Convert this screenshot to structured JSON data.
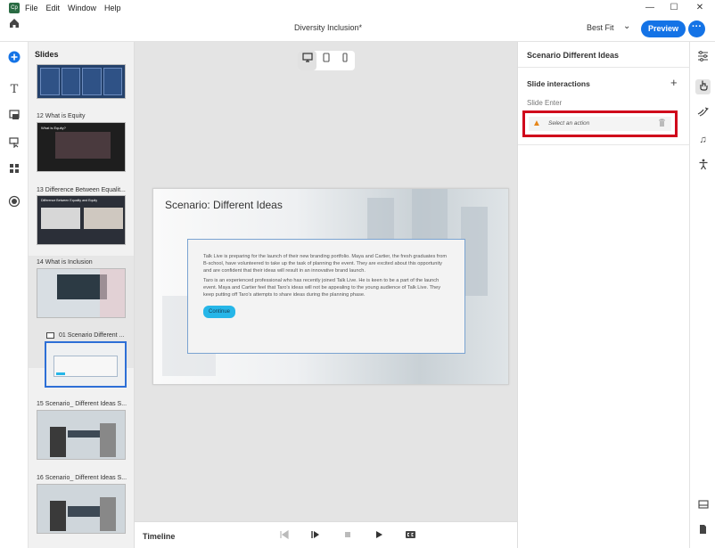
{
  "menu": {
    "app_logo": "Cp",
    "items": [
      "File",
      "Edit",
      "Window",
      "Help"
    ]
  },
  "window_controls": {
    "minimize": "—",
    "maximize": "☐",
    "close": "✕"
  },
  "header": {
    "doc_title": "Diversity Inclusion*",
    "zoom": "Best Fit",
    "preview_label": "Preview",
    "more_label": "···",
    "accent_color": "#1473e6"
  },
  "slides_panel": {
    "title": "Slides",
    "slides": [
      {
        "label": "12  What is Equity",
        "thumb_title": "What is Equity?"
      },
      {
        "label": "13  Difference Between Equalit...",
        "thumb_title": "Difference Between Equality and Equity"
      },
      {
        "label": "14  What is Inclusion"
      },
      {
        "label": "01  Scenario Different ..."
      },
      {
        "label": "15  Scenario_ Different Ideas S..."
      },
      {
        "label": "16  Scenario_ Different Ideas S..."
      }
    ]
  },
  "canvas": {
    "slide_heading": "Scenario: Different Ideas",
    "paragraph1": "Talk Live is preparing for the launch of their new branding portfolio. Maya and Cartier, the fresh graduates from B-school, have volunteered to take up the task of planning the event. They are excited about this opportunity and are confident that their ideas will result in an innovative brand launch.",
    "paragraph2": "Taro is an experienced professional who has recently joined Talk Live. He is keen to be a part of the launch event. Maya and Cartier feel that Taro's ideas will not be appealing to the young audience of Talk Live. They keep putting off Taro's attempts to share ideas during the planning phase.",
    "continue_label": "Continue"
  },
  "timeline": {
    "label": "Timeline"
  },
  "properties": {
    "title": "Scenario Different Ideas",
    "section": "Slide interactions",
    "trigger": "Slide Enter",
    "action_placeholder": "Select an action",
    "highlight_color": "#d0021b"
  }
}
